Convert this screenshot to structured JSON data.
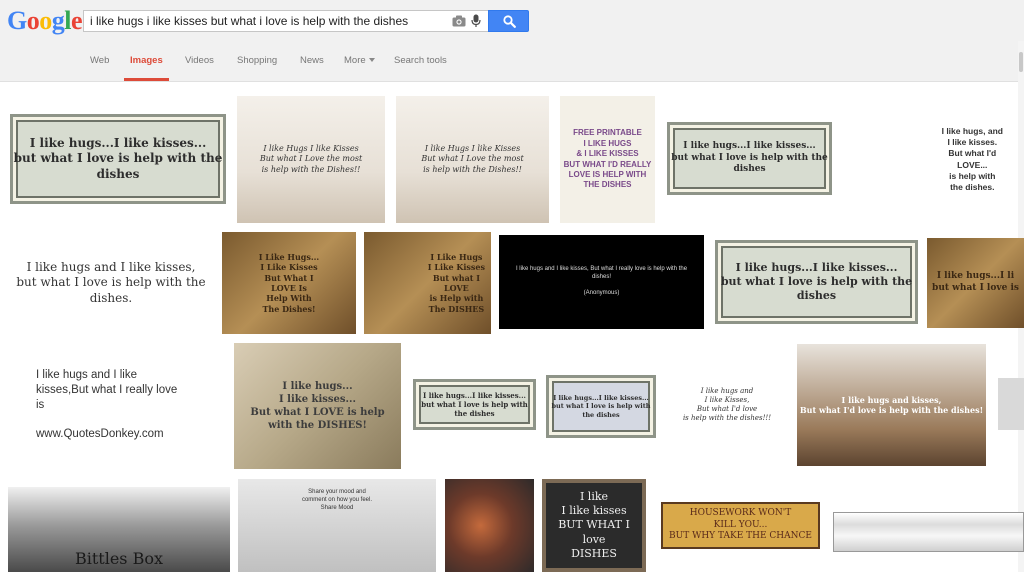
{
  "header": {
    "logo_letters": [
      {
        "char": "G",
        "color": "#4285f4"
      },
      {
        "char": "o",
        "color": "#ea4335"
      },
      {
        "char": "o",
        "color": "#fbbc05"
      },
      {
        "char": "g",
        "color": "#4285f4"
      },
      {
        "char": "l",
        "color": "#34a853"
      },
      {
        "char": "e",
        "color": "#ea4335"
      }
    ],
    "search_value": "i like hugs i like kisses but what i love is help with the dishes",
    "icons": {
      "camera": "camera-icon",
      "mic": "microphone-icon",
      "search": "search-icon"
    }
  },
  "tabs": [
    {
      "label": "Web"
    },
    {
      "label": "Images"
    },
    {
      "label": "Videos"
    },
    {
      "label": "Shopping"
    },
    {
      "label": "News"
    },
    {
      "label": "More"
    },
    {
      "label": "Search tools"
    }
  ],
  "results": [
    {
      "text": "I like hugs...I like kisses...\nbut what I love is help with the dishes"
    },
    {
      "text": "I like Hugs I like Kisses\nBut what I Love the most\nis help with the Dishes!!"
    },
    {
      "text": "I like Hugs I like Kisses\nBut what I Love the most\nis help with the Dishes!!"
    },
    {
      "text": "FREE PRINTABLE\nI LIKE HUGS\n& I LIKE KISSES\nBUT WHAT I'D REALLY\nLOVE IS HELP WITH THE DISHES"
    },
    {
      "text": "I like hugs...I like kisses...\nbut what I love is help with the dishes"
    },
    {
      "text": "I like hugs, and\nI like kisses.\nBut what I'd\nLOVE...\nis help with\nthe dishes."
    },
    {
      "text": "I like hugs and I like kisses,\nbut what I love is help with the dishes."
    },
    {
      "text": "I Like Hugs...\nI Like Kisses\nBut What I\nLOVE Is\nHelp With\nThe Dishes!"
    },
    {
      "text": "I Like Hugs\nI Like Kisses\nBut what I\nLOVE\nis Help with\nThe DISHES"
    },
    {
      "text": "I like hugs and I like kisses, But what I really love is help with the dishes!\n\n(Anonymous)"
    },
    {
      "text": "I like hugs...I like kisses...\nbut what I love is help with the dishes"
    },
    {
      "text": "I like hugs...I li\nbut what I love is"
    },
    {
      "text": "I like hugs and I like\nkisses,But what I really love\nis\n\nwww.QuotesDonkey.com"
    },
    {
      "text": "I like hugs...\nI like kisses...\nBut what I LOVE is help\nwith the DISHES!"
    },
    {
      "text": "I like hugs...I like kisses...\nbut what I love is help with the dishes"
    },
    {
      "text": "I like hugs...I like kisses...\nbut what I love is help with the dishes"
    },
    {
      "text": "I like hugs and\nI like Kisses,\nBut what I'd love\nis help with the dishes!!!"
    },
    {
      "text": "I like hugs and kisses,\nBut what I'd love is help with the dishes!"
    },
    {
      "text": ""
    },
    {
      "text": "Bittles Box"
    },
    {
      "text": "Share your mood and\ncomment on how you feel.\nShare Mood"
    },
    {
      "text": ""
    },
    {
      "text": "I like\nI like kisses\nBUT WHAT I love\nDISHES"
    },
    {
      "text": "HOUSEWORK WON'T\nKILL YOU...\nBUT WHY TAKE THE CHANCE"
    },
    {
      "text": ""
    }
  ]
}
